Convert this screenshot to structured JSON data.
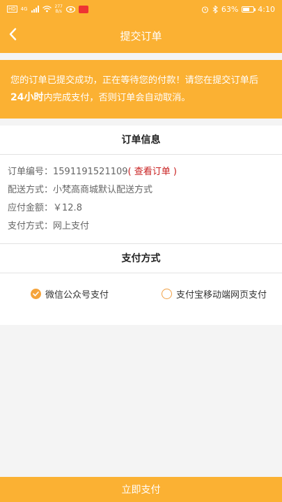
{
  "status_bar": {
    "network_badge": "HD",
    "network_badge2": "4G",
    "net_speed_value": "277",
    "net_speed_unit": "B/s",
    "battery": "63%",
    "time": "4:10"
  },
  "nav": {
    "title": "提交订单"
  },
  "notice": {
    "line1": "您的订单已提交成功，正在等待您的付款！请您在提交订单后",
    "highlight": "24小时",
    "line2_rest": "内完成支付，否则订单会自动取消。"
  },
  "order_info": {
    "title": "订单信息",
    "order_no_label": "订单编号：",
    "order_no_value": "1591191521109",
    "view_order_link": "( 查看订单 )",
    "delivery_label": "配送方式：",
    "delivery_value": "小梵高商城默认配送方式",
    "amount_label": "应付金额：",
    "amount_value": "￥12.8",
    "pay_method_label": "支付方式：",
    "pay_method_value": "网上支付"
  },
  "payment": {
    "title": "支付方式",
    "options": [
      {
        "label": "微信公众号支付",
        "selected": true
      },
      {
        "label": "支付宝移动端网页支付",
        "selected": false
      }
    ]
  },
  "submit_label": "立即支付",
  "colors": {
    "accent": "#fbb133",
    "link": "#c81e1e"
  }
}
